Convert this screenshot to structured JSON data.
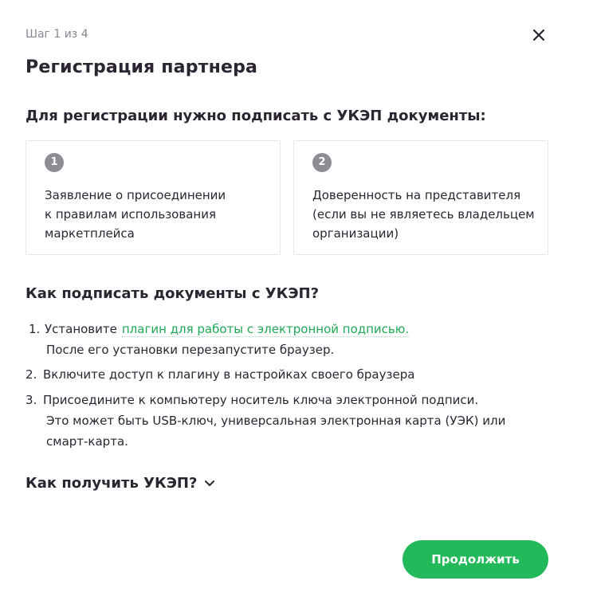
{
  "header": {
    "step": "Шаг 1 из 4",
    "title": "Регистрация партнера"
  },
  "documents": {
    "heading": "Для регистрации нужно подписать с УКЭП документы:",
    "cards": [
      {
        "number": "1",
        "text": "Заявление о присоединении\nк правилам использования\nмаркетплейса"
      },
      {
        "number": "2",
        "text": "Доверенность на представителя\n(если вы не являетесь владельцем\nорганизации)"
      }
    ]
  },
  "how_to_sign": {
    "heading": "Как подписать документы с УКЭП?",
    "steps": [
      {
        "number": "1.",
        "text": "Установите",
        "link": "плагин для работы с электронной подписью.",
        "sub": "После его установки перезапустите браузер."
      },
      {
        "number": "2.",
        "text": "Включите доступ к плагину в настройках своего браузера"
      },
      {
        "number": "3.",
        "text": "Присоедините к компьютеру носитель ключа электронной подписи.",
        "sub": "Это может быть USB-ключ, универсальная электронная карта (УЭК) или\nсмарт-карта."
      }
    ]
  },
  "faq": {
    "label": "Как получить УКЭП?"
  },
  "actions": {
    "continue_label": "Продолжить"
  },
  "colors": {
    "accent": "#22b95a",
    "link": "#1fa856",
    "badge": "#8f8c93"
  },
  "icons": {
    "close": "close-icon",
    "expand": "chevron-down-icon"
  }
}
